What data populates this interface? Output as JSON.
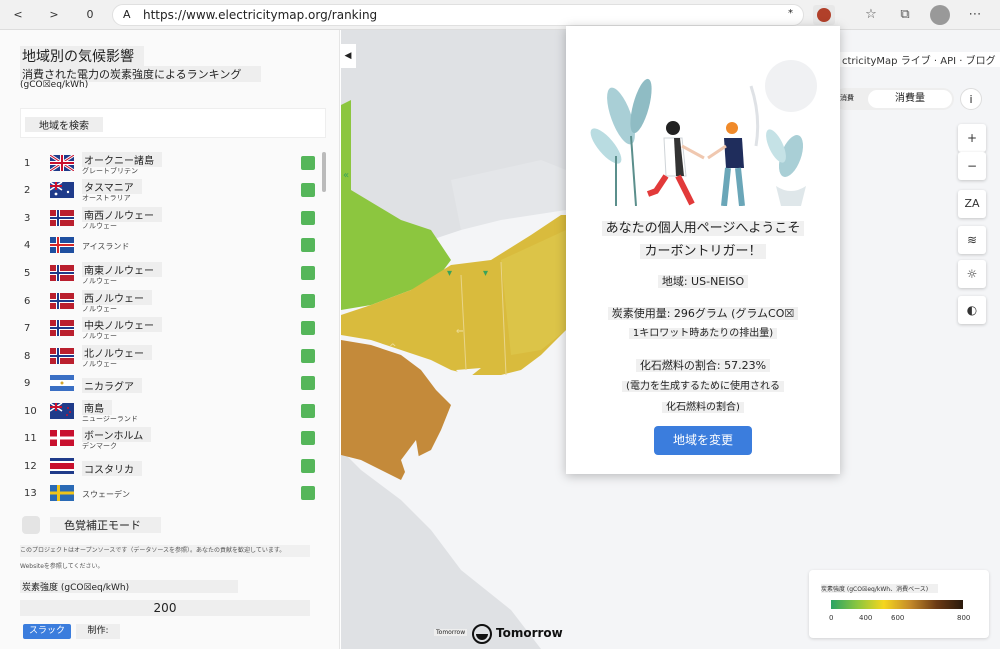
{
  "browser": {
    "back_label": "<",
    "forward_label": ">",
    "refresh_label": "0",
    "reader_label": "A",
    "url": "https://www.electricitymap.org/ranking",
    "star_label": "*"
  },
  "left_panel": {
    "title": "地域別の気候影響",
    "subtitle": "消費された電力の炭素強度によるランキング",
    "unit": "(gCO☒eq/kWh)",
    "search_placeholder": "地域を検索",
    "rankings": [
      {
        "rank": "1",
        "name": "オークニー諸島",
        "country": "グレートブリテン",
        "flag": "gb"
      },
      {
        "rank": "2",
        "name": "タスマニア",
        "country": "オーストラリア",
        "flag": "au"
      },
      {
        "rank": "3",
        "name": "南西ノルウェー",
        "country": "ノルウェー",
        "flag": "no"
      },
      {
        "rank": "4",
        "name": "",
        "country": "アイスランド",
        "flag": "is"
      },
      {
        "rank": "5",
        "name": "南東ノルウェー",
        "country": "ノルウェー",
        "flag": "no"
      },
      {
        "rank": "6",
        "name": "西ノルウェー",
        "country": "ノルウェー",
        "flag": "no"
      },
      {
        "rank": "7",
        "name": "中央ノルウェー",
        "country": "ノルウェー",
        "flag": "no"
      },
      {
        "rank": "8",
        "name": "北ノルウェー",
        "country": "ノルウェー",
        "flag": "no"
      },
      {
        "rank": "9",
        "name": "ニカラグア",
        "country": "",
        "flag": "ni"
      },
      {
        "rank": "10",
        "name": "南島",
        "country": "ニュージーランド",
        "flag": "nz"
      },
      {
        "rank": "11",
        "name": "ボーンホルム",
        "country": "デンマーク",
        "flag": "dk"
      },
      {
        "rank": "12",
        "name": "コスタリカ",
        "country": "",
        "flag": "cr"
      },
      {
        "rank": "13",
        "name": "",
        "country": "スウェーデン",
        "flag": "se"
      }
    ],
    "colorblind_label": "色覚補正モード",
    "info_line1": "このプロジェクトはオープンソースです（データソースを参照）。あなたの貢献を歓迎しています。",
    "info_line2": "Websiteを参照してください。",
    "slider_label": "炭素強度 (gCO☒eq/kWh)",
    "slider_value": "200",
    "slack_label": "スラック",
    "make_label": "制作:"
  },
  "map_controls": {
    "nav_links": "ctricityMap ライブ · API · ブログ",
    "toggle_a": "消費",
    "toggle_b": "消費量",
    "info_label": "i",
    "zoom_in": "+",
    "zoom_out": "−",
    "lang_label": "ZA",
    "wind_icon": "wind-icon",
    "sun_icon": "sun-icon",
    "contrast_icon": "contrast-icon"
  },
  "legend": {
    "title": "炭素強度 (gCO☒eq/kWh、消費ベース)",
    "ticks": [
      "0",
      "400",
      "600",
      "800"
    ]
  },
  "brand": {
    "small": "Tomorrow",
    "name": "Tomorrow"
  },
  "popup": {
    "welcome_line1": "あなたの個人用ページへようこそ",
    "welcome_line2": "カーボントリガー！",
    "region": "地域: US-NEISO",
    "carbon_line1": "炭素使用量: 296グラム (グラムCO☒",
    "carbon_line2": "1キロワット時あたりの排出量)",
    "fossil_line1": "化石燃料の割合: 57.23%",
    "fossil_line2": "(電力を生成するために使用される",
    "fossil_line3": "化石燃料の割合)",
    "change_button": "地域を変更"
  },
  "colors": {
    "accent": "#3b7ddd",
    "swatch_green": "#55b65a",
    "map_green": "#8cc63f",
    "map_yellow": "#d9bb3d",
    "map_brown": "#c48a3a"
  }
}
